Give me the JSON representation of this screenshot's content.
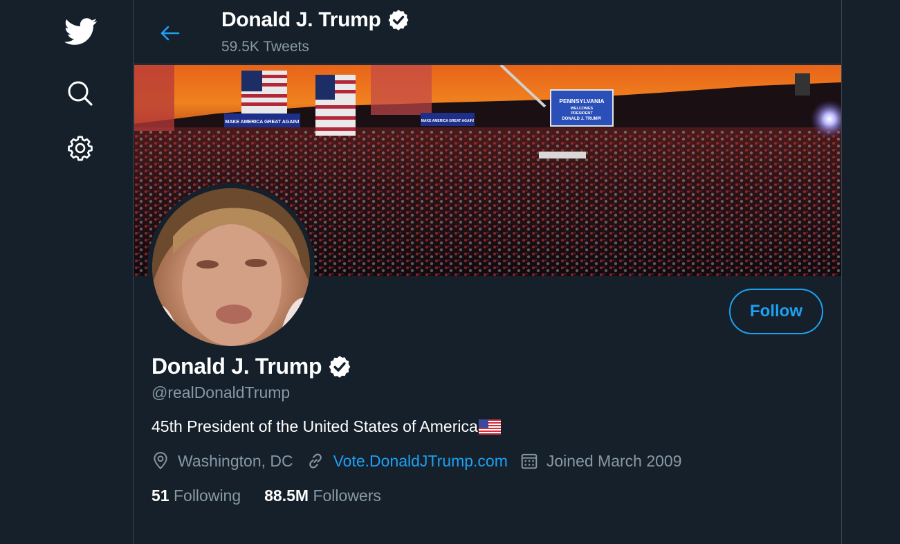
{
  "header": {
    "name": "Donald J. Trump",
    "tweets_count": "59.5K Tweets"
  },
  "banner": {
    "sign_main": "PENNSYLVANIA",
    "sign_line2": "WELCOMES",
    "sign_line3": "PRESIDENT",
    "sign_line4": "DONALD J. TRUMP!",
    "banner_left": "MAKE AMERICA GREAT AGAIN!",
    "banner_mid": "MAKE AMERICA GREAT AGAIN!"
  },
  "profile": {
    "name": "Donald J. Trump",
    "handle": "@realDonaldTrump",
    "bio": "45th President of the United States of America",
    "location": "Washington, DC",
    "website": "Vote.DonaldJTrump.com",
    "joined": "Joined March 2009",
    "following_count": "51",
    "following_label": "Following",
    "followers_count": "88.5M",
    "followers_label": "Followers",
    "follow_button": "Follow"
  },
  "colors": {
    "background": "#15202b",
    "accent": "#1da1f2",
    "muted": "#8899a6",
    "border": "#38444d"
  },
  "icons": [
    "twitter-logo-icon",
    "search-icon",
    "gear-icon",
    "back-arrow-icon",
    "verified-badge-icon",
    "location-pin-icon",
    "link-icon",
    "calendar-icon",
    "us-flag-icon"
  ]
}
